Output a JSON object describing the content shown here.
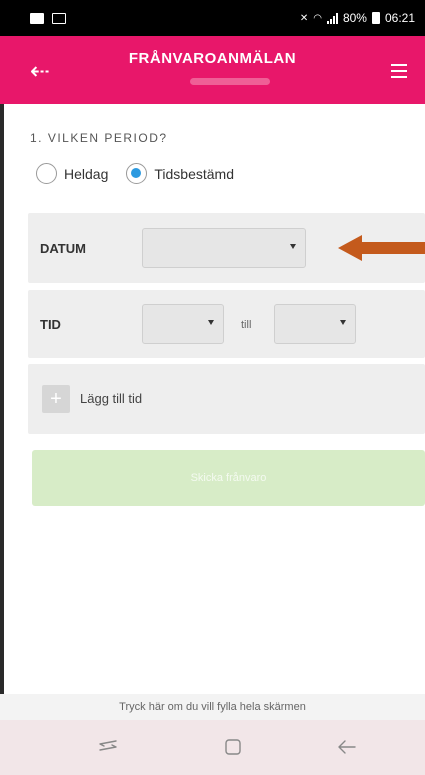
{
  "status_bar": {
    "battery": "80%",
    "time": "06:21"
  },
  "header": {
    "title": "FRÅNVAROANMÄLAN"
  },
  "period": {
    "label": "1. VILKEN PERIOD?",
    "options": [
      {
        "label": "Heldag",
        "selected": false
      },
      {
        "label": "Tidsbestämd",
        "selected": true
      }
    ]
  },
  "datum": {
    "label": "DATUM",
    "value": ""
  },
  "tid": {
    "label": "TID",
    "from_value": "",
    "separator": "till",
    "to_value": ""
  },
  "add_time": {
    "icon": "plus-icon",
    "label": "Lägg till tid"
  },
  "submit": {
    "label": "Skicka frånvaro"
  },
  "fullscreen_hint": "Tryck här om du vill fylla hela skärmen",
  "colors": {
    "brand": "#e8176a",
    "radio_selected": "#2d9ae0",
    "submit_bg": "#d7ecc7",
    "annotation_arrow": "#c45a1c"
  },
  "navigation": {
    "icons": [
      "recent-apps-icon",
      "home-icon",
      "back-icon"
    ]
  }
}
